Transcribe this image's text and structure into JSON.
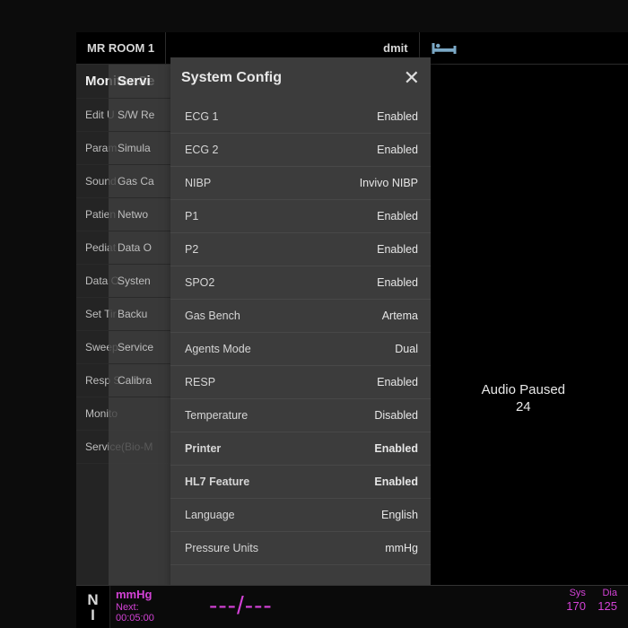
{
  "topbar": {
    "room": "MR ROOM 1",
    "admit": "dmit"
  },
  "panelA": {
    "title": "Monitor Se",
    "rows": [
      "Edit U",
      "Param",
      "Sound",
      "Patien",
      "Pediat",
      "Data O",
      "Set Tir",
      "Sweep",
      "Resp S",
      "Monito",
      "Service(Bio-M"
    ]
  },
  "panelB": {
    "title": "Servi",
    "rows": [
      "S/W Re",
      "Simula",
      "Gas Ca",
      "Netwo",
      "Data O",
      "Systen",
      "Backu",
      "Service",
      "Calibra"
    ]
  },
  "syscfg": {
    "title": "System Config",
    "items": [
      {
        "label": "ECG 1",
        "value": "Enabled"
      },
      {
        "label": "ECG 2",
        "value": "Enabled"
      },
      {
        "label": "NIBP",
        "value": "Invivo NIBP"
      },
      {
        "label": "P1",
        "value": "Enabled"
      },
      {
        "label": "P2",
        "value": "Enabled"
      },
      {
        "label": "SPO2",
        "value": "Enabled"
      },
      {
        "label": "Gas Bench",
        "value": "Artema"
      },
      {
        "label": "Agents Mode",
        "value": "Dual"
      },
      {
        "label": "RESP",
        "value": "Enabled"
      },
      {
        "label": "Temperature",
        "value": "Disabled"
      },
      {
        "label": "Printer",
        "value": "Enabled",
        "bold": true
      },
      {
        "label": "HL7 Feature",
        "value": "Enabled",
        "bold": true
      },
      {
        "label": "Language",
        "value": "English"
      },
      {
        "label": "Pressure Units",
        "value": "mmHg"
      }
    ]
  },
  "audio": {
    "status": "Audio Paused",
    "count": "24"
  },
  "bottom": {
    "ni_top": "N",
    "ni_bot": "I",
    "unit": "mmHg",
    "next_label": "Next:",
    "timer": "00:05:00",
    "reading": "---/---",
    "sys_label": "Sys",
    "dia_label": "Dia",
    "sys_val": "170",
    "dia_val": "125"
  }
}
